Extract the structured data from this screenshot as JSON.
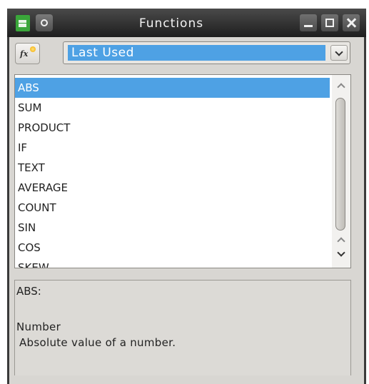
{
  "window": {
    "title": "Functions"
  },
  "toolbar": {
    "fx_button_label": "fx",
    "category_selected": "Last Used"
  },
  "function_list": {
    "selected_index": 0,
    "items": [
      "ABS",
      "SUM",
      "PRODUCT",
      "IF",
      "TEXT",
      "AVERAGE",
      "COUNT",
      "SIN",
      "COS",
      "SKEW"
    ]
  },
  "description": {
    "function_signature": "ABS:",
    "argument_name": "Number",
    "summary": "Absolute value of a number."
  },
  "colors": {
    "selection": "#4ea1e4",
    "titlebar": "#2a2a2a",
    "dialog_background": "#d8d6d2"
  }
}
